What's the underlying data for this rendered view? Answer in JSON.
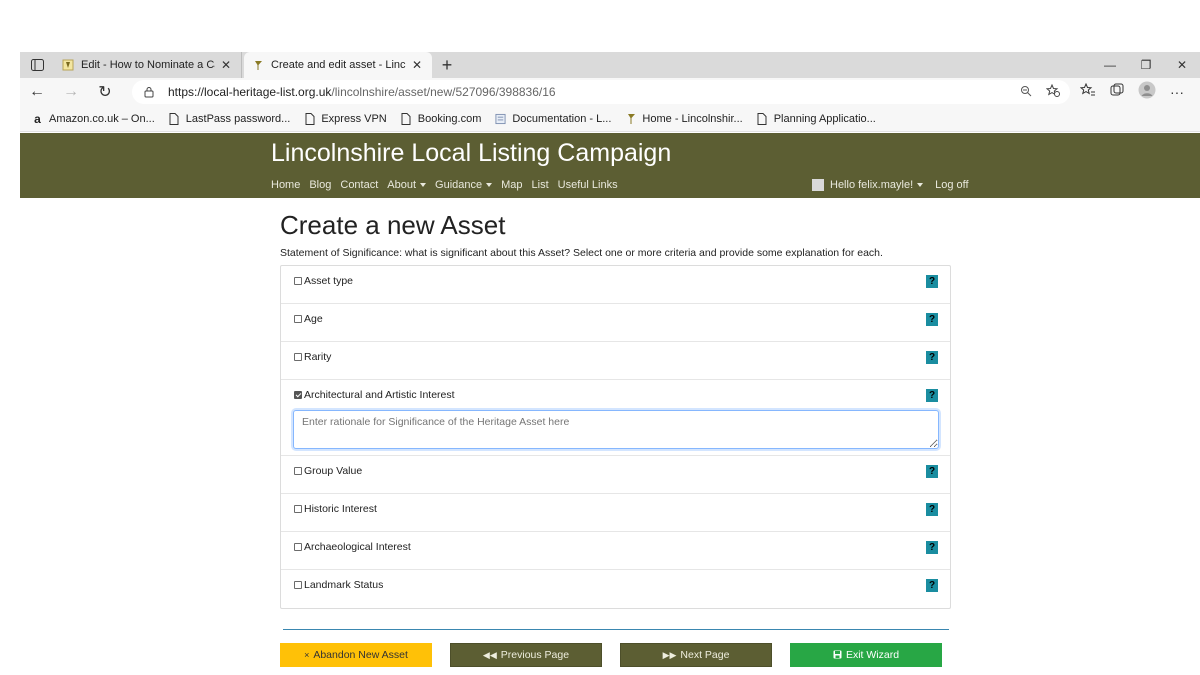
{
  "browser": {
    "tabs": [
      {
        "title": "Edit - How to Nominate a Candida",
        "active": false
      },
      {
        "title": "Create and edit asset - Lincolnsh",
        "active": true
      }
    ],
    "new_tab": "+",
    "window_controls": {
      "minimize": "—",
      "restore": "❐",
      "close": "✕"
    },
    "url": {
      "host": "https://local-heritage-list.org.uk",
      "path": "/lincolnshire/asset/new/527096/398836/16"
    },
    "bookmarks": [
      {
        "label": "Amazon.co.uk – On...",
        "icon": "amazon-icon"
      },
      {
        "label": "LastPass password...",
        "icon": "page-icon"
      },
      {
        "label": "Express VPN",
        "icon": "page-icon"
      },
      {
        "label": "Booking.com",
        "icon": "page-icon"
      },
      {
        "label": "Documentation - L...",
        "icon": "doc-icon"
      },
      {
        "label": "Home - Lincolnshir...",
        "icon": "pin-icon"
      },
      {
        "label": "Planning Applicatio...",
        "icon": "page-icon"
      }
    ]
  },
  "site": {
    "title": "Lincolnshire Local Listing Campaign",
    "nav": {
      "home": "Home",
      "blog": "Blog",
      "contact": "Contact",
      "about": "About",
      "guidance": "Guidance",
      "map": "Map",
      "list": "List",
      "useful_links": "Useful Links"
    },
    "user": {
      "greeting": "Hello felix.mayle!",
      "logoff": "Log off"
    },
    "header_color": "#5c5e33"
  },
  "main": {
    "title": "Create a new Asset",
    "intro": "Statement of Significance: what is significant about this Asset? Select one or more criteria and provide some explanation for each.",
    "criteria": [
      {
        "label": "Asset type",
        "checked": false
      },
      {
        "label": "Age",
        "checked": false
      },
      {
        "label": "Rarity",
        "checked": false
      },
      {
        "label": "Architectural and Artistic Interest",
        "checked": true,
        "rationale_placeholder": "Enter rationale for Significance of the Heritage Asset here"
      },
      {
        "label": "Group Value",
        "checked": false
      },
      {
        "label": "Historic Interest",
        "checked": false
      },
      {
        "label": "Archaeological Interest",
        "checked": false
      },
      {
        "label": "Landmark Status",
        "checked": false
      }
    ],
    "help_label": "?"
  },
  "actions": {
    "abandon": {
      "label": "Abandon New Asset",
      "icon": "×",
      "color": "#ffc107"
    },
    "previous": {
      "label": "Previous Page",
      "icon": "◀◀",
      "color": "#5c5e33"
    },
    "next": {
      "label": "Next Page",
      "icon": "▶▶",
      "color": "#5c5e33"
    },
    "exit": {
      "label": "Exit Wizard",
      "icon": "💾",
      "color": "#28a745"
    }
  }
}
